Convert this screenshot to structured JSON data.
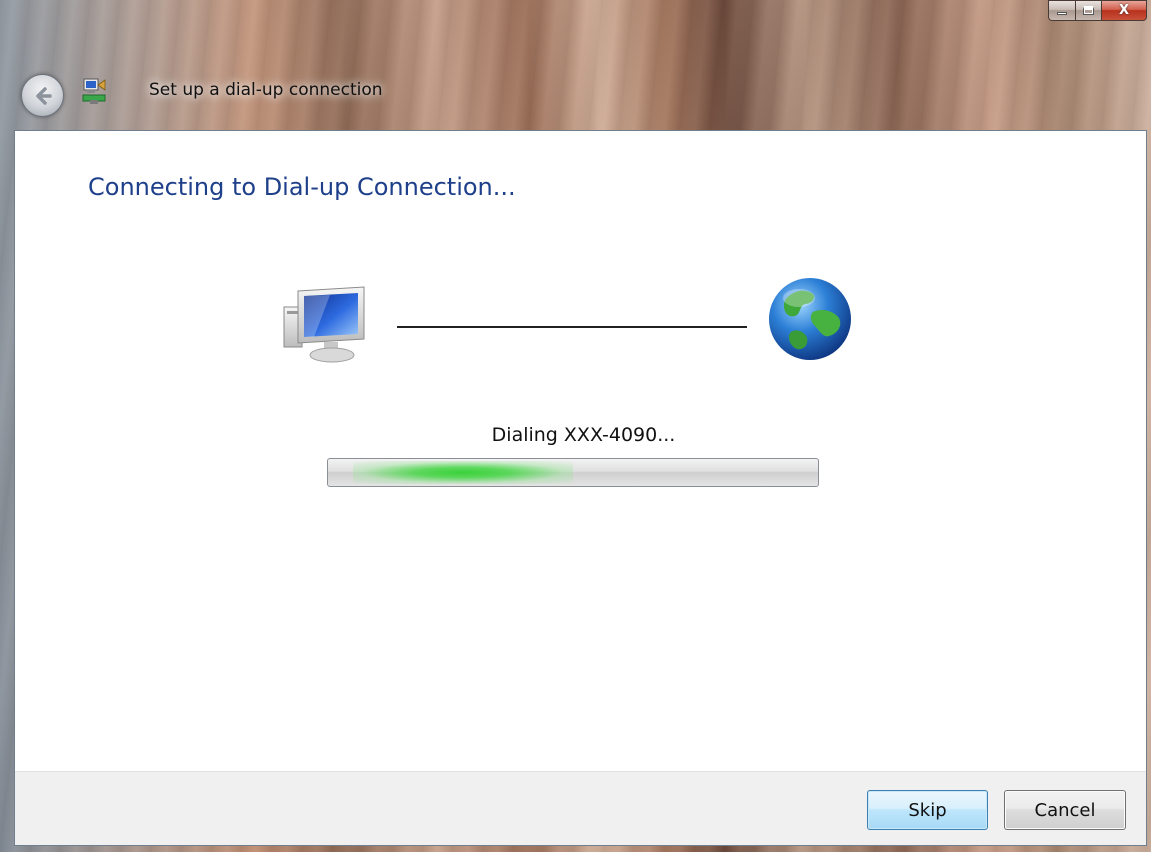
{
  "window": {
    "title": "Set up a dial-up connection",
    "caption_buttons": {
      "minimize_icon": "minimize-icon",
      "maximize_icon": "maximize-icon",
      "close_glyph": "X"
    }
  },
  "header": {
    "back_icon": "back-arrow-icon",
    "app_icon": "network-connection-icon"
  },
  "main": {
    "heading": "Connecting to Dial-up Connection...",
    "local_icon": "computer-icon",
    "remote_icon": "globe-icon",
    "status": "Dialing XXX-4090...",
    "progress": {
      "type": "marquee",
      "glow_start_fraction": 0.05,
      "glow_end_fraction": 0.5,
      "color": "#3ad23a"
    }
  },
  "footer": {
    "skip_label": "Skip",
    "cancel_label": "Cancel"
  },
  "colors": {
    "heading": "#1e3f8a",
    "default_button_border": "#3c7fb1"
  }
}
